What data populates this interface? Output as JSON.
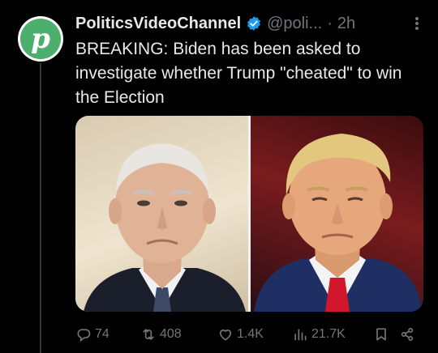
{
  "post": {
    "avatar_letter": "p",
    "display_name": "PoliticsVideoChannel",
    "handle": "@poli...",
    "separator": "·",
    "time": "2h",
    "text": "BREAKING: Biden has been asked to investigate whether Trump \"cheated\" to win the Election"
  },
  "stats": {
    "replies": "74",
    "reposts": "408",
    "likes": "1.4K",
    "views": "21.7K"
  },
  "icons": {
    "verified": "verified-badge-icon",
    "more": "more-vertical-icon",
    "reply": "reply-icon",
    "repost": "repost-icon",
    "like": "heart-icon",
    "views": "views-bar-chart-icon",
    "bookmark": "bookmark-icon",
    "share": "share-icon"
  },
  "colors": {
    "background": "#000000",
    "text": "#e7e9ea",
    "muted": "#71767b",
    "verified": "#1d9bf0",
    "avatar": "#4caf6e"
  }
}
